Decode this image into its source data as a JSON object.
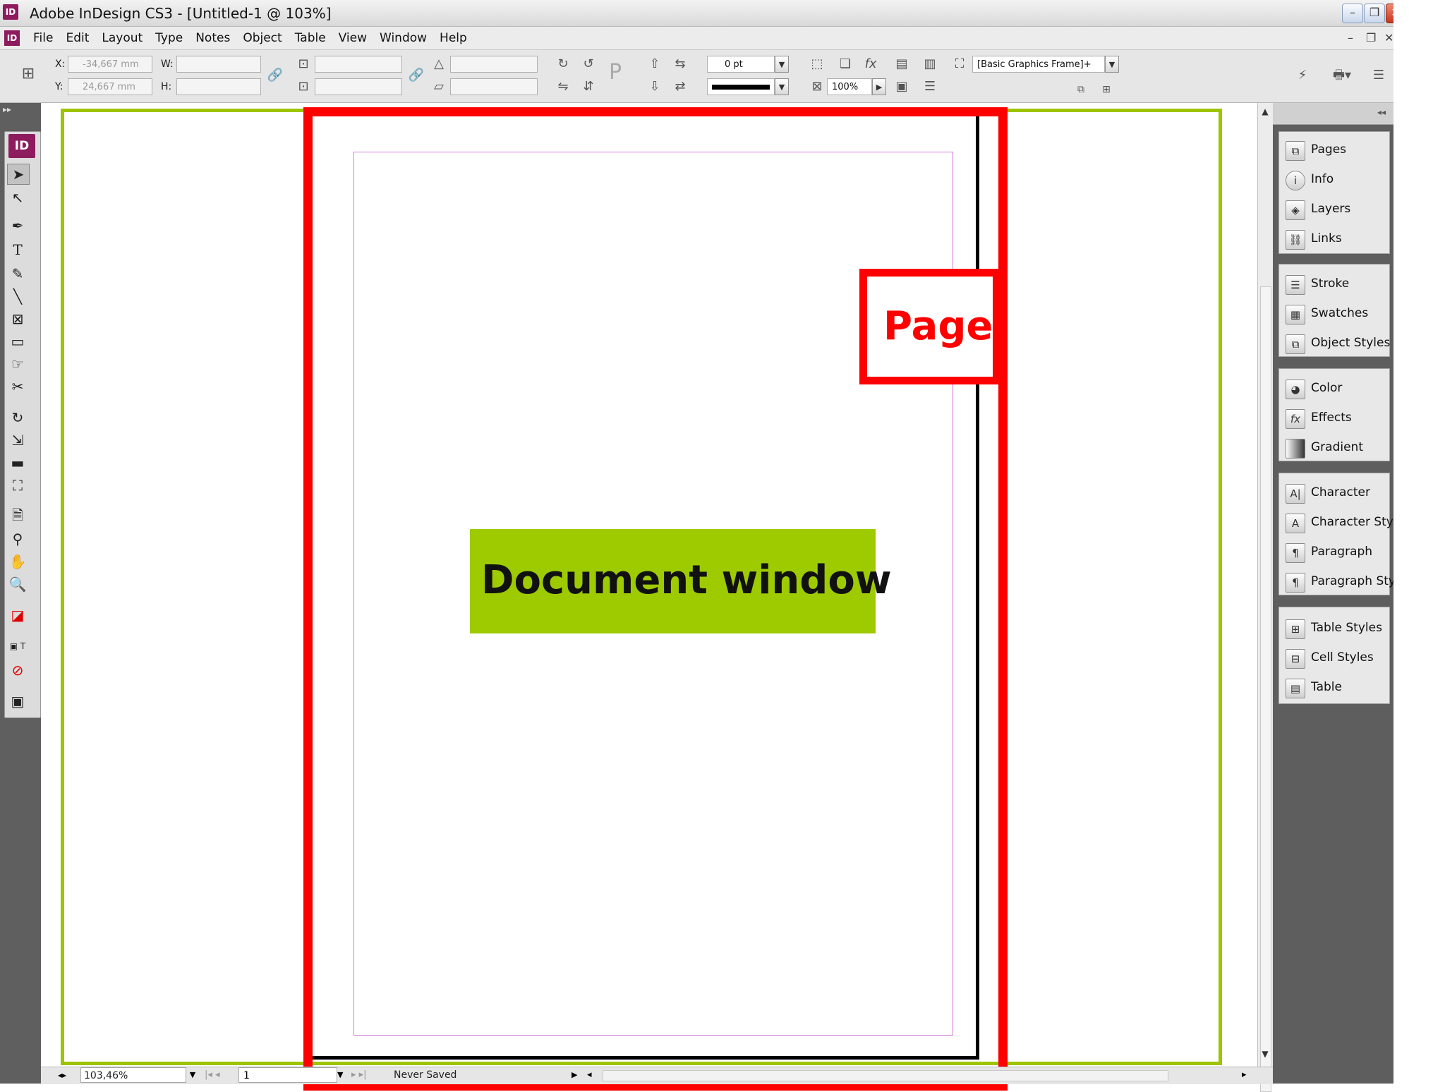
{
  "window": {
    "title": "Adobe InDesign CS3 - [Untitled-1 @ 103%]",
    "app_icon_text": "ID"
  },
  "menubar": {
    "items": [
      "File",
      "Edit",
      "Layout",
      "Type",
      "Notes",
      "Object",
      "Table",
      "View",
      "Window",
      "Help"
    ]
  },
  "control_panel": {
    "x_label": "X:",
    "y_label": "Y:",
    "w_label": "W:",
    "h_label": "H:",
    "x_value": "-34,667 mm",
    "y_value": "24,667 mm",
    "stroke_weight": "0 pt",
    "opacity": "100%",
    "object_style": "[Basic Graphics Frame]+"
  },
  "toolbox": {
    "logo_text": "ID"
  },
  "canvas": {
    "page_label": "Page",
    "document_window_label": "Document window",
    "colors": {
      "frame_green": "#9ec400",
      "label_red": "#ff0000",
      "label_green_bg": "#9ecb00",
      "margin_magenta": "#d37ad8"
    }
  },
  "statusbar": {
    "zoom": "103,46%",
    "page_number": "1",
    "save_state": "Never Saved"
  },
  "panels": {
    "groups": [
      [
        "Pages",
        "Info",
        "Layers",
        "Links"
      ],
      [
        "Stroke",
        "Swatches",
        "Object Styles"
      ],
      [
        "Color",
        "Effects",
        "Gradient"
      ],
      [
        "Character",
        "Character Styles",
        "Paragraph",
        "Paragraph Styles"
      ],
      [
        "Table Styles",
        "Cell Styles",
        "Table"
      ]
    ],
    "icons": {
      "Pages": "pages-icon",
      "Info": "info-icon",
      "Layers": "layers-icon",
      "Links": "links-icon",
      "Stroke": "stroke-icon",
      "Swatches": "swatches-icon",
      "Object Styles": "object-styles-icon",
      "Color": "color-icon",
      "Effects": "effects-icon",
      "Gradient": "gradient-icon",
      "Character": "character-icon",
      "Character Styles": "character-styles-icon",
      "Paragraph": "paragraph-icon",
      "Paragraph Styles": "paragraph-styles-icon",
      "Table Styles": "table-styles-icon",
      "Cell Styles": "cell-styles-icon",
      "Table": "table-icon"
    }
  }
}
